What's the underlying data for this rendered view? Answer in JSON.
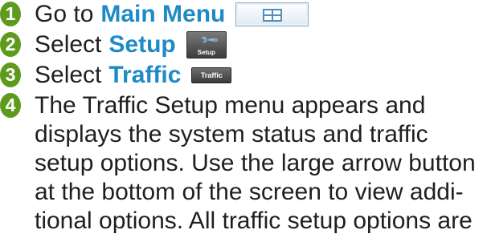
{
  "steps": [
    {
      "number": "1",
      "prefix": "Go to",
      "target": "Main Menu",
      "icon": "main-menu-grid-icon"
    },
    {
      "number": "2",
      "prefix": "Select",
      "target": "Setup",
      "icon": "setup-wrench-icon",
      "button_label": "Setup"
    },
    {
      "number": "3",
      "prefix": "Select",
      "target": "Traffic",
      "button_label": "Traffic"
    }
  ],
  "step4": {
    "number": "4",
    "lines": [
      "The Traffic Setup menu appears and",
      "displays the system status and traffic",
      "setup options. Use the large arrow button",
      "at the bottom of the screen to view addi-",
      "tional options. All traffic setup options are"
    ]
  },
  "colors": {
    "badge": "#5e9b1d",
    "target_text": "#1e8ac6",
    "body_text": "#1f1f1f"
  }
}
